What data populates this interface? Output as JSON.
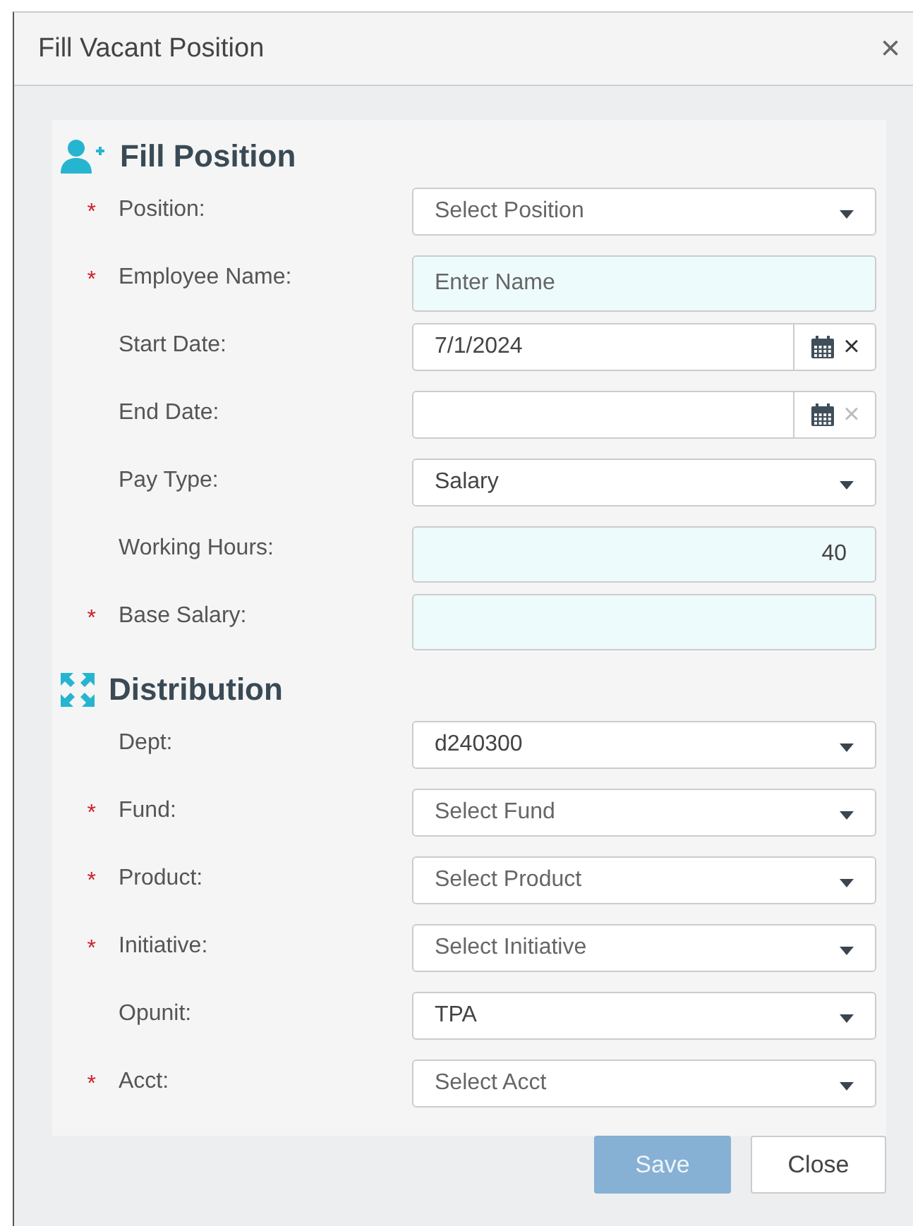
{
  "dialog": {
    "title": "Fill Vacant Position",
    "close_glyph": "×",
    "required_glyph": "*"
  },
  "sections": [
    {
      "title": "Fill Position",
      "fields": [
        {
          "label": "Position:",
          "required": true,
          "kind": "select",
          "placeholder": "Select Position"
        },
        {
          "label": "Employee Name:",
          "required": true,
          "kind": "text",
          "placeholder": "Enter Name"
        },
        {
          "label": "Start Date:",
          "required": false,
          "kind": "date",
          "value": "7/1/2024",
          "clear_glyph": "×"
        },
        {
          "label": "End Date:",
          "required": false,
          "kind": "date",
          "clear_glyph": "×"
        },
        {
          "label": "Pay Type:",
          "required": false,
          "kind": "select",
          "value": "Salary"
        },
        {
          "label": "Working Hours:",
          "required": false,
          "kind": "number",
          "value": "40"
        },
        {
          "label": "Base Salary:",
          "required": true,
          "kind": "number"
        }
      ]
    },
    {
      "title": "Distribution",
      "fields": [
        {
          "label": "Dept:",
          "required": false,
          "kind": "select",
          "value": "d240300"
        },
        {
          "label": "Fund:",
          "required": true,
          "kind": "select",
          "placeholder": "Select Fund"
        },
        {
          "label": "Product:",
          "required": true,
          "kind": "select",
          "placeholder": "Select Product"
        },
        {
          "label": "Initiative:",
          "required": true,
          "kind": "select",
          "placeholder": "Select Initiative"
        },
        {
          "label": "Opunit:",
          "required": false,
          "kind": "select",
          "value": "TPA"
        },
        {
          "label": "Acct:",
          "required": true,
          "kind": "select",
          "placeholder": "Select Acct"
        }
      ]
    }
  ],
  "buttons": [
    {
      "label": "Save",
      "kind": "primary",
      "disabled": true
    },
    {
      "label": "Close",
      "kind": "default",
      "disabled": false
    }
  ]
}
